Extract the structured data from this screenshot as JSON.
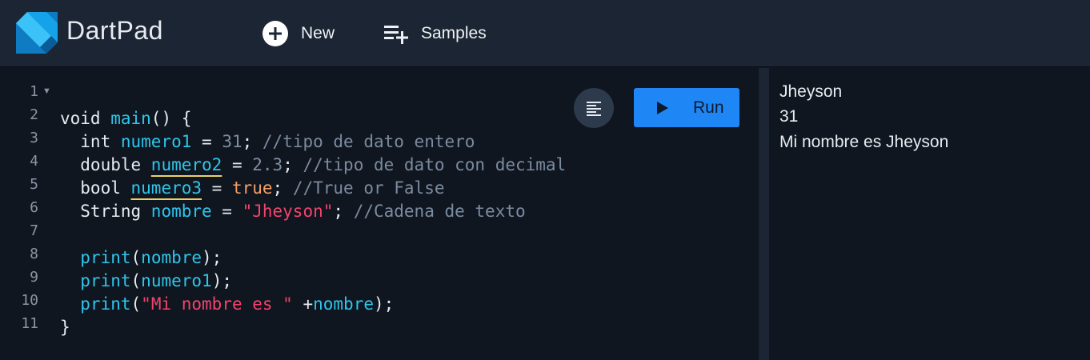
{
  "app": {
    "title": "DartPad"
  },
  "toolbar": {
    "new_label": "New",
    "samples_label": "Samples"
  },
  "editor": {
    "run_label": "Run",
    "line_numbers": [
      "1",
      "2",
      "3",
      "4",
      "5",
      "6",
      "7",
      "8",
      "9",
      "10",
      "11"
    ]
  },
  "output": {
    "lines": [
      "Jheyson",
      "31",
      "Mi nombre es Jheyson"
    ]
  },
  "code": {
    "l1": {
      "t1": "void ",
      "t2": "main",
      "t3": "() {"
    },
    "l2": {
      "t1": "  int ",
      "t2": "numero1",
      "t3": " = ",
      "t4": "31",
      "t5": "; ",
      "t6": "//tipo de dato entero"
    },
    "l3": {
      "t1": "  double ",
      "t2": "numero2",
      "t3": " = ",
      "t4": "2.3",
      "t5": "; ",
      "t6": "//tipo de dato con decimal"
    },
    "l4": {
      "t1": "  bool ",
      "t2": "numero3",
      "t3": " = ",
      "t4": "true",
      "t5": "; ",
      "t6": "//True or False"
    },
    "l5": {
      "t1": "  String ",
      "t2": "nombre",
      "t3": " = ",
      "t4": "\"Jheyson\"",
      "t5": "; ",
      "t6": "//Cadena de texto"
    },
    "l7": {
      "t1": "  print",
      "t2": "(",
      "t3": "nombre",
      "t4": ");"
    },
    "l8": {
      "t1": "  print",
      "t2": "(",
      "t3": "numero1",
      "t4": ");"
    },
    "l9": {
      "t1": "  print",
      "t2": "(",
      "t3": "\"Mi nombre es \"",
      "t4": " +",
      "t5": "nombre",
      "t6": ");"
    },
    "l10": {
      "t1": "}"
    }
  },
  "colors": {
    "accent": "#1f87f5",
    "background": "#0f161f",
    "topbar": "#1b2533"
  },
  "icons": {
    "logo": "dart-logo",
    "new": "add-circle-icon",
    "samples": "playlist-add-icon",
    "format": "format-align-icon",
    "run": "play-icon"
  }
}
